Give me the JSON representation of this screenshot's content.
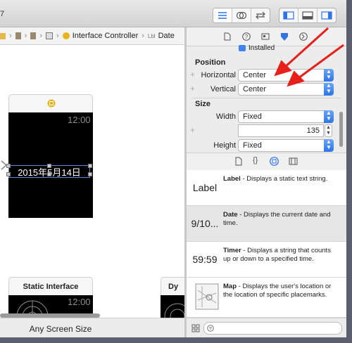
{
  "toolbar": {
    "title_fragment": "7"
  },
  "jumpbar": {
    "items": [
      "Interface Controller",
      "Date"
    ]
  },
  "canvas": {
    "time": "12:00",
    "date_label": "2015年5月14日",
    "scene2_title": "Static Interface",
    "scene2_time": "12:00",
    "scene3_title": "Dy",
    "size_label": "Any Screen Size"
  },
  "inspector": {
    "installed_label": "Installed",
    "position": {
      "title": "Position",
      "horizontal_label": "Horizontal",
      "horizontal_value": "Center",
      "vertical_label": "Vertical",
      "vertical_value": "Center"
    },
    "size": {
      "title": "Size",
      "width_label": "Width",
      "width_value": "Fixed",
      "width_number": "135",
      "height_label": "Height",
      "height_value": "Fixed"
    }
  },
  "library": {
    "items": [
      {
        "glyph": "Label",
        "name": "Label",
        "desc": " - Displays a static text string."
      },
      {
        "glyph": "9/10...",
        "name": "Date",
        "desc": " - Displays the current date and time."
      },
      {
        "glyph": "59:59",
        "name": "Timer",
        "desc": " - Displays a string that counts up or down to a specified time."
      },
      {
        "glyph": "",
        "name": "Map",
        "desc": " - Displays the user's location or the location of specific placemarks."
      }
    ]
  },
  "colors": {
    "accent": "#2f74e6",
    "arrow": "#e8201a"
  }
}
